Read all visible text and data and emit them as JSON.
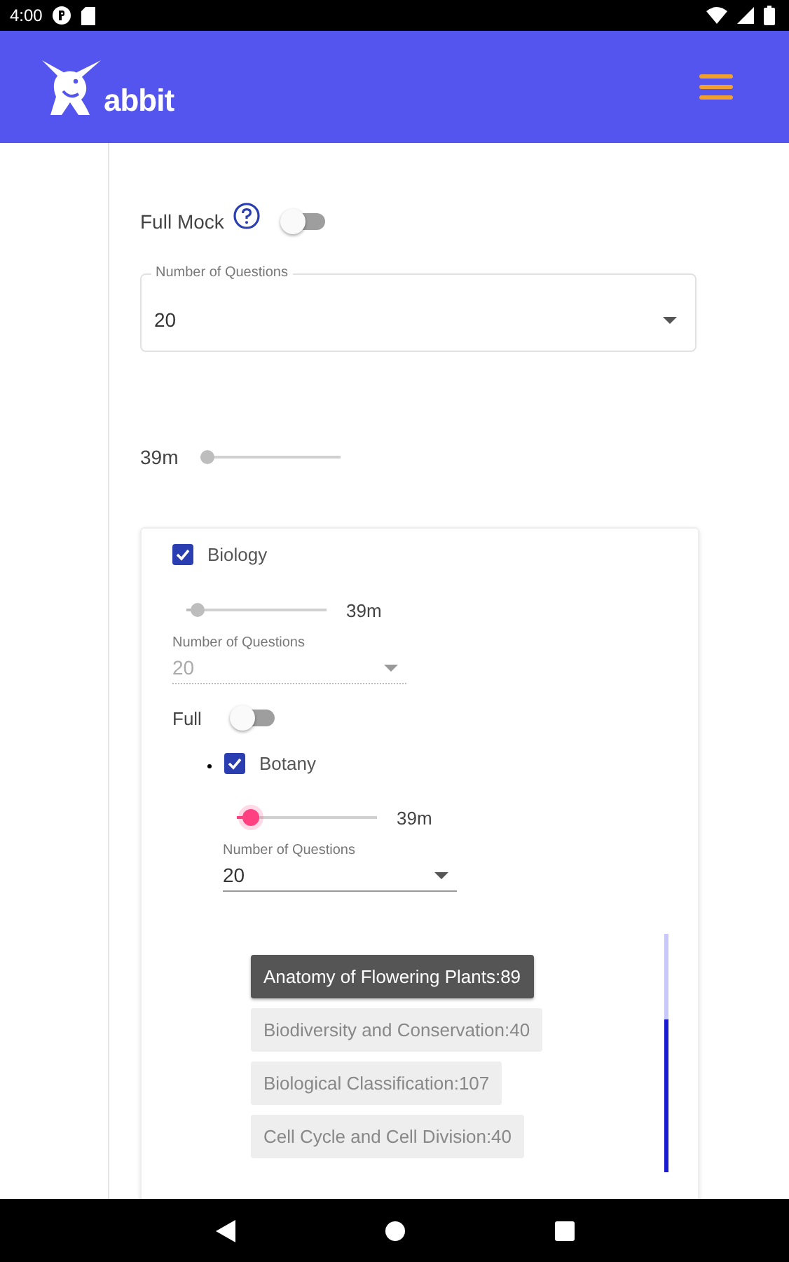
{
  "status_bar": {
    "time": "4:00"
  },
  "app_bar": {
    "logo_text": "abbit"
  },
  "full_mock": {
    "label": "Full Mock",
    "on": false
  },
  "question_count": {
    "label": "Number of Questions",
    "value": "20"
  },
  "duration": {
    "reading": "39m",
    "level": 0.05,
    "disabled": true
  },
  "subjects": [
    {
      "name": "Biology",
      "checked": true,
      "duration": {
        "reading": "39m",
        "level": 0.08,
        "disabled": true
      },
      "question_count": {
        "label": "Number of Questions",
        "value": "20",
        "disabled": true
      },
      "full": {
        "label": "Full",
        "on": false
      },
      "children": [
        {
          "name": "Botany",
          "checked": true,
          "duration": {
            "reading": "39m",
            "level": 0.1,
            "disabled": false
          },
          "question_count": {
            "label": "Number of Questions",
            "value": "20",
            "disabled": false
          },
          "chapters": [
            {
              "label": "Anatomy of Flowering Plants:89",
              "selected": true
            },
            {
              "label": "Biodiversity and Conservation:40",
              "selected": false
            },
            {
              "label": "Biological Classification:107",
              "selected": false
            },
            {
              "label": "Cell Cycle and Cell Division:40",
              "selected": false
            }
          ]
        }
      ]
    }
  ]
}
